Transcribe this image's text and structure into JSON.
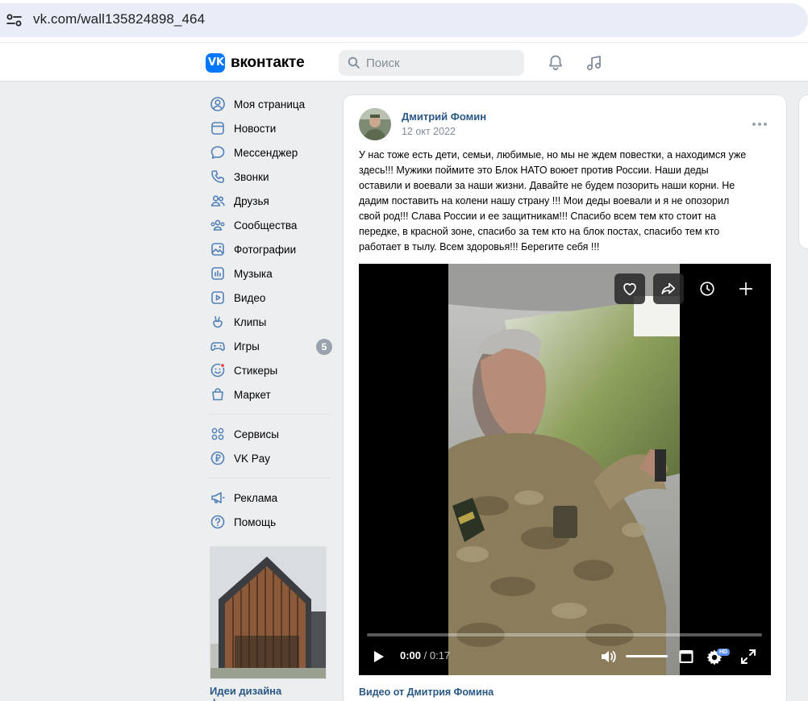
{
  "browser": {
    "url": "vk.com/wall135824898_464"
  },
  "header": {
    "brand": "вконтакте",
    "search_placeholder": "Поиск",
    "colors": {
      "brand_blue": "#0077ff",
      "link": "#2a5885"
    }
  },
  "sidebar": {
    "items": [
      {
        "label": "Моя страница",
        "icon": "user-circle-icon"
      },
      {
        "label": "Новости",
        "icon": "news-icon"
      },
      {
        "label": "Мессенджер",
        "icon": "chat-bubble-icon"
      },
      {
        "label": "Звонки",
        "icon": "phone-icon"
      },
      {
        "label": "Друзья",
        "icon": "friends-icon"
      },
      {
        "label": "Сообщества",
        "icon": "communities-icon"
      },
      {
        "label": "Фотографии",
        "icon": "photo-icon"
      },
      {
        "label": "Музыка",
        "icon": "music-icon"
      },
      {
        "label": "Видео",
        "icon": "video-icon"
      },
      {
        "label": "Клипы",
        "icon": "clips-icon"
      },
      {
        "label": "Игры",
        "icon": "gamepad-icon",
        "badge": "5"
      },
      {
        "label": "Стикеры",
        "icon": "sticker-icon"
      },
      {
        "label": "Маркет",
        "icon": "market-bag-icon"
      }
    ],
    "items2": [
      {
        "label": "Сервисы",
        "icon": "services-grid-icon"
      },
      {
        "label": "VK Pay",
        "icon": "vkpay-icon"
      }
    ],
    "items3": [
      {
        "label": "Реклама",
        "icon": "megaphone-icon"
      },
      {
        "label": "Помощь",
        "icon": "help-icon"
      }
    ],
    "ad": {
      "title": "Идеи дизайна фасадов"
    }
  },
  "post": {
    "author": "Дмитрий Фомин",
    "date": "12 окт 2022",
    "text": "У нас тоже есть дети, семьи, любимые, но мы не ждем повестки, а находимся уже\nздесь!!! Мужики поймите это Блок НАТО воюет против России. Наши деды\nоставили и воевали за наши жизни. Давайте не будем позорить наши корни. Не\nдадим поставить на колени нашу страну !!! Мои деды воевали и я не опозорил\nсвой род!!! Слава России и ее защитникам!!! Спасибо всем тем кто стоит на\nпередке, в красной зоне, спасибо за тем кто на блок постах, спасибо тем кто\nработает в тылу. Всем здоровья!!! Берегите себя !!!",
    "video": {
      "current_time": "0:00",
      "total_time": " / 0:17",
      "progress": 0,
      "volume": 1,
      "hd_label": "HD"
    },
    "video_caption": "Видео от Дмитрия Фомина"
  }
}
